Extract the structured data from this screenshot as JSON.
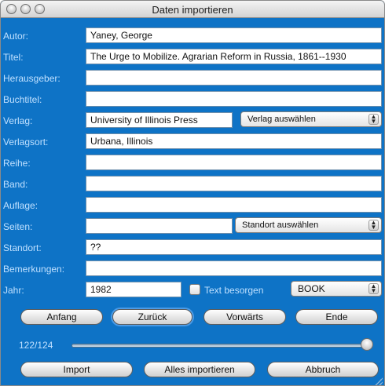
{
  "window": {
    "title": "Daten importieren"
  },
  "fields": {
    "autor": {
      "label": "Autor:",
      "value": "Yaney, George"
    },
    "titel": {
      "label": "Titel:",
      "value": "The Urge to Mobilize. Agrarian Reform in Russia, 1861--1930"
    },
    "herausgeber": {
      "label": "Herausgeber:",
      "value": ""
    },
    "buchtitel": {
      "label": "Buchtitel:",
      "value": ""
    },
    "verlag": {
      "label": "Verlag:",
      "value": "University of Illinois Press",
      "popup": "Verlag auswählen"
    },
    "verlagsort": {
      "label": "Verlagsort:",
      "value": "Urbana, Illinois"
    },
    "reihe": {
      "label": "Reihe:",
      "value": ""
    },
    "band": {
      "label": "Band:",
      "value": ""
    },
    "auflage": {
      "label": "Auflage:",
      "value": ""
    },
    "seiten": {
      "label": "Seiten:",
      "value": "",
      "popup": "Standort auswählen"
    },
    "standort": {
      "label": "Standort:",
      "value": "??"
    },
    "bemerkungen": {
      "label": "Bemerkungen:",
      "value": ""
    },
    "jahr": {
      "label": "Jahr:",
      "value": "1982",
      "checkbox_label": "Text besorgen",
      "type_value": "BOOK"
    }
  },
  "nav": {
    "anfang": "Anfang",
    "zurueck": "Zurück",
    "vorwaerts": "Vorwärts",
    "ende": "Ende"
  },
  "slider": {
    "label": "122/124",
    "current": 122,
    "total": 124
  },
  "actions": {
    "import": "Import",
    "alles": "Alles importieren",
    "abbruch": "Abbruch"
  }
}
